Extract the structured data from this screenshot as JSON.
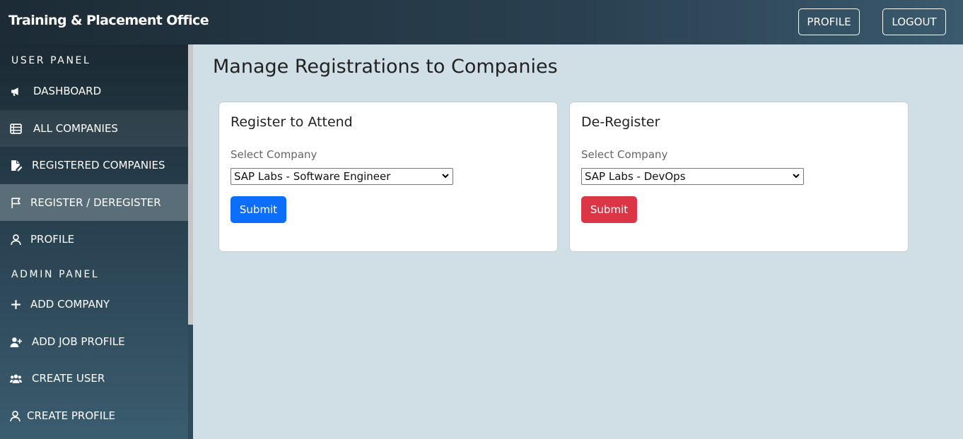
{
  "app": {
    "title": "Training & Placement Office"
  },
  "header": {
    "profile_label": "PROFILE",
    "logout_label": "LOGOUT"
  },
  "sidebar": {
    "user_panel_title": "USER PANEL",
    "admin_panel_title": "ADMIN PANEL",
    "user_items": [
      {
        "label": "DASHBOARD",
        "icon": "megaphone-icon"
      },
      {
        "label": "ALL COMPANIES",
        "icon": "list-icon"
      },
      {
        "label": "REGISTERED COMPANIES",
        "icon": "file-edit-icon"
      },
      {
        "label": "REGISTER / DEREGISTER",
        "icon": "flag-icon",
        "active": true
      },
      {
        "label": "PROFILE",
        "icon": "user-icon"
      }
    ],
    "admin_items": [
      {
        "label": "ADD COMPANY",
        "icon": "plus-icon"
      },
      {
        "label": "ADD JOB PROFILE",
        "icon": "user-plus-icon"
      },
      {
        "label": "CREATE USER",
        "icon": "users-icon"
      },
      {
        "label": "CREATE PROFILE",
        "icon": "user-icon"
      }
    ]
  },
  "main": {
    "title": "Manage Registrations to Companies",
    "register_card": {
      "title": "Register to Attend",
      "label": "Select Company",
      "selected": "SAP Labs - Software Engineer",
      "submit_label": "Submit"
    },
    "deregister_card": {
      "title": "De-Register",
      "label": "Select Company",
      "selected": "SAP Labs - DevOps",
      "submit_label": "Submit"
    }
  },
  "colors": {
    "primary": "#0d6efd",
    "danger": "#dc3545",
    "background": "#d0dee6"
  }
}
